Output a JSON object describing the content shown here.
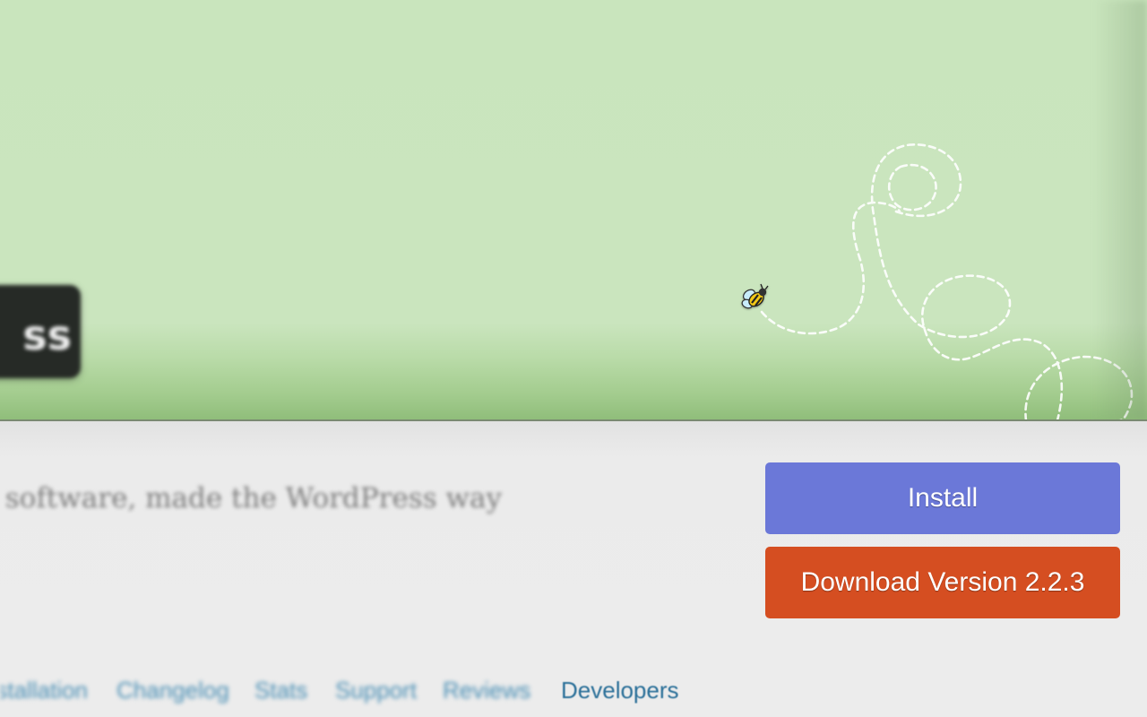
{
  "banner": {
    "title_fragment": "ss",
    "bee_icon": "bee-icon",
    "colors": {
      "banner_green": "#c9e5bd",
      "badge": "#262a26"
    }
  },
  "plugin": {
    "tagline": "um software, made the WordPress way"
  },
  "actions": {
    "install_label": "Install",
    "download_label": "Download Version 2.2.3",
    "install_color": "#6b78d8",
    "download_color": "#d54e21"
  },
  "tabs": [
    {
      "label": "Installation"
    },
    {
      "label": "Changelog"
    },
    {
      "label": "Stats"
    },
    {
      "label": "Support"
    },
    {
      "label": "Reviews"
    },
    {
      "label": "Developers"
    }
  ]
}
